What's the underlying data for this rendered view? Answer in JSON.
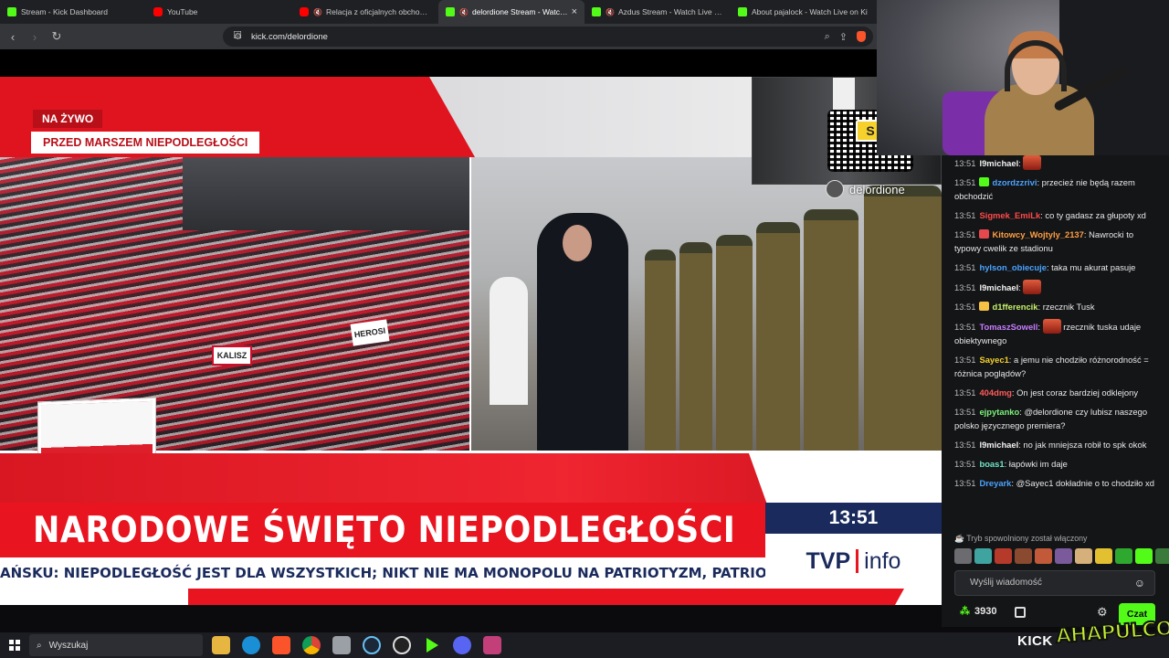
{
  "browser": {
    "tabs": [
      {
        "title": "Stream - Kick Dashboard",
        "favicon": "kick",
        "active": false
      },
      {
        "title": "YouTube",
        "favicon": "youtube",
        "active": false
      },
      {
        "title": "Relacja z oficjalnych obchodów N",
        "favicon": "youtube",
        "active": false,
        "muted": true
      },
      {
        "title": "delordione Stream - Watch L",
        "favicon": "kick",
        "active": true,
        "muted": true
      },
      {
        "title": "Azdus Stream - Watch Live on Ki",
        "favicon": "kick",
        "active": false,
        "muted": true
      },
      {
        "title": "About pajalock - Watch Live on Ki",
        "favicon": "kick",
        "active": false
      }
    ],
    "url": "kick.com/delordione"
  },
  "video": {
    "live_label": "NA ŻYWO",
    "topic_label": "PRZED MARSZEM NIEPODLEGŁOŚCI",
    "crowd_banner_1": "KALISZ",
    "crowd_banner_2": "HEROSI",
    "headline": "NARODOWE ŚWIĘTO NIEPODLEGŁOŚCI",
    "clock": "13:51",
    "channel_logo_left": "TVP",
    "channel_logo_right": "info",
    "ticker": "AŃSKU: NIEPODLEGŁOŚĆ JEST DLA WSZYSTKICH; NIKT NIE MA MONOPOLU NA PATRIOTYZM, PATRIOTYZM",
    "qr_badge": "S",
    "qr_handle": "delordione"
  },
  "chat": {
    "messages": [
      {
        "time": "13:51",
        "user": "l9michael",
        "color": "#f2f2f2",
        "text": "",
        "emote": true
      },
      {
        "time": "13:51",
        "user": "dzordzzrivi",
        "color": "#4aa3ff",
        "badge": "#53fc18",
        "text": "przecież nie będą razem obchodzić"
      },
      {
        "time": "13:51",
        "user": "Sigmek_EmiLk",
        "color": "#ff4a4a",
        "text": "co ty gadasz za głupoty xd"
      },
      {
        "time": "13:51",
        "user": "Kitowcy_Wojtyly_2137",
        "color": "#ff9f43",
        "badge": "#e5484d",
        "text": "Nawrocki to typowy cwelik ze stadionu"
      },
      {
        "time": "13:51",
        "user": "hylson_obiecuje",
        "color": "#4aa3ff",
        "text": "taka mu akurat pasuje"
      },
      {
        "time": "13:51",
        "user": "l9michael",
        "color": "#f2f2f2",
        "text": "",
        "emote": true
      },
      {
        "time": "13:51",
        "user": "d1fferencik",
        "color": "#c8f26a",
        "badge": "#f6c244",
        "text": "rzecznik Tusk"
      },
      {
        "time": "13:51",
        "user": "TomaszSowell",
        "color": "#c77dff",
        "text": "rzecznik tuska udaje obiektywnego",
        "emote": true
      },
      {
        "time": "13:51",
        "user": "Sayec1",
        "color": "#f6d12c",
        "text": "a jemu nie chodziło różnorodność = różnica poglądów?"
      },
      {
        "time": "13:51",
        "user": "404dmg",
        "color": "#ff5a5a",
        "text": "On jest coraz bardziej odklejony"
      },
      {
        "time": "13:51",
        "user": "ejpytanko",
        "color": "#7cf27c",
        "text": "@delordione czy lubisz naszego polsko języcznego premiera?"
      },
      {
        "time": "13:51",
        "user": "l9michael",
        "color": "#f2f2f2",
        "text": "no jak mniejsza robił to spk okok"
      },
      {
        "time": "13:51",
        "user": "boas1",
        "color": "#6fe3c8",
        "text": "łapówki im daje"
      },
      {
        "time": "13:51",
        "user": "Dreyark",
        "color": "#4aa3ff",
        "text": "@Sayec1 dokładnie o to chodziło xd"
      }
    ],
    "slow_mode_notice": "Tryb spowolniony został włączony",
    "input_placeholder": "Wyślij wiadomość",
    "points_value": "3930",
    "send_label": "Czat"
  },
  "overlay": {
    "kick_text": "KICK",
    "brand_text": "AHAPULCO"
  },
  "taskbar": {
    "search_placeholder": "Wyszukaj"
  },
  "colors": {
    "kick_green": "#53fc18",
    "tvp_red": "#e8141f",
    "tvp_navy": "#1a2a5c"
  }
}
